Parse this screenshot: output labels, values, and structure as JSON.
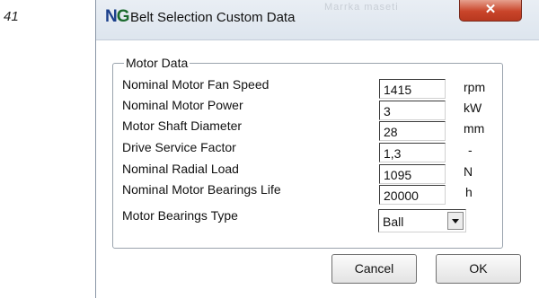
{
  "page_number": "41",
  "window": {
    "logo": {
      "left": "N",
      "right": "G"
    },
    "title": "Belt Selection Custom Data",
    "background_text": "Marrka   maseti",
    "close_icon": "close-icon"
  },
  "group": {
    "title": "Motor Data",
    "fields": [
      {
        "label": "Nominal Motor Fan Speed",
        "value": "1415",
        "unit": "rpm"
      },
      {
        "label": "Nominal Motor Power",
        "value": "3",
        "unit": "kW"
      },
      {
        "label": "Motor Shaft Diameter",
        "value": "28",
        "unit": "mm"
      },
      {
        "label": "Drive Service Factor",
        "value": "1,3",
        "unit": "-"
      },
      {
        "label": "Nominal Radial Load",
        "value": "1095",
        "unit": "N"
      },
      {
        "label": "Nominal Motor Bearings Life",
        "value": "20000",
        "unit": "h"
      }
    ],
    "bearings_label": "Motor Bearings Type",
    "bearings_value": "Ball"
  },
  "buttons": {
    "cancel": "Cancel",
    "ok": "OK"
  },
  "colors": {
    "logo_n": "#1b3f8b",
    "logo_g": "#1b6a2e",
    "close_button": "#c9452a"
  }
}
